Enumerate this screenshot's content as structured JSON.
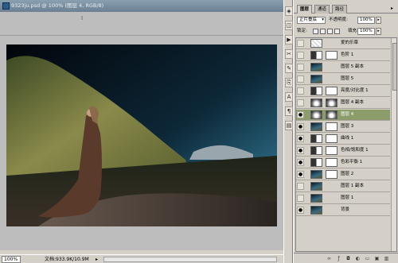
{
  "document": {
    "title": "9323ju.psd @ 100% (图层 4, RGB/8)",
    "zoom": "100%",
    "info": "文档:933.9K/10.9M",
    "status_arrow": "▸",
    "ruler_marker": "I"
  },
  "mini_tools": [
    {
      "name": "navigator-icon",
      "glyph": "◈"
    },
    {
      "name": "history-icon",
      "glyph": "◫"
    },
    {
      "name": "actions-icon",
      "glyph": "▶"
    },
    {
      "name": "tools-icon",
      "glyph": "✂"
    },
    {
      "name": "brush-icon",
      "glyph": "✎"
    },
    {
      "name": "clone-icon",
      "glyph": "⎘"
    },
    {
      "name": "text-icon",
      "glyph": "A"
    },
    {
      "name": "paragraph-icon",
      "glyph": "¶"
    },
    {
      "name": "info-icon",
      "glyph": "▤"
    }
  ],
  "panel": {
    "tabs": [
      "图层",
      "通道",
      "路径"
    ],
    "menu_glyph": "▸",
    "blend_mode": "正片叠底",
    "blend_arrow": "▾",
    "opacity_label": "不透明度:",
    "opacity_value": "100%",
    "lock_label": "锁定:",
    "fill_label": "填充:",
    "fill_value": "100%",
    "spin_glyph": "▸"
  },
  "layers": [
    {
      "name": "爱的乐章",
      "visible": false,
      "thumb": "text",
      "mask": false
    },
    {
      "name": "色阶 1",
      "visible": false,
      "thumb": "adjust",
      "mask": true
    },
    {
      "name": "图层 5 副本",
      "visible": false,
      "thumb": "photo",
      "mask": false
    },
    {
      "name": "图层 5",
      "visible": false,
      "thumb": "photo",
      "mask": false
    },
    {
      "name": "亮度/对比度 1",
      "visible": false,
      "thumb": "adjust",
      "mask": true
    },
    {
      "name": "图层 4 副本",
      "visible": false,
      "thumb": "glow",
      "mask": true
    },
    {
      "name": "图层 4",
      "visible": true,
      "thumb": "glow",
      "mask": true,
      "selected": true
    },
    {
      "name": "图层 3",
      "visible": true,
      "thumb": "photo",
      "mask": true
    },
    {
      "name": "曲线 1",
      "visible": true,
      "thumb": "adjust",
      "mask": true
    },
    {
      "name": "色相/饱和度 1",
      "visible": true,
      "thumb": "adjust",
      "mask": true
    },
    {
      "name": "色彩平衡 1",
      "visible": true,
      "thumb": "adjust",
      "mask": true
    },
    {
      "name": "图层 2",
      "visible": true,
      "thumb": "photo",
      "mask": true
    },
    {
      "name": "图层 1 副本",
      "visible": false,
      "thumb": "photo",
      "mask": false
    },
    {
      "name": "图层 1",
      "visible": false,
      "thumb": "photo",
      "mask": false
    },
    {
      "name": "背景",
      "visible": true,
      "thumb": "photo",
      "mask": false
    }
  ],
  "panel_buttons": [
    {
      "name": "link-layers-icon",
      "glyph": "∞"
    },
    {
      "name": "layer-style-icon",
      "glyph": "ƒ"
    },
    {
      "name": "add-mask-icon",
      "glyph": "◘"
    },
    {
      "name": "adjustment-layer-icon",
      "glyph": "◐"
    },
    {
      "name": "new-group-icon",
      "glyph": "▭"
    },
    {
      "name": "new-layer-icon",
      "glyph": "▣"
    },
    {
      "name": "delete-layer-icon",
      "glyph": "▥"
    }
  ],
  "colors": {
    "selected_layer": "#8c9c6a",
    "sky_top": "#05080c",
    "sky_glow": "#2f6f8a",
    "hill": "#6b7a3a",
    "dress": "#5a3a2a"
  }
}
